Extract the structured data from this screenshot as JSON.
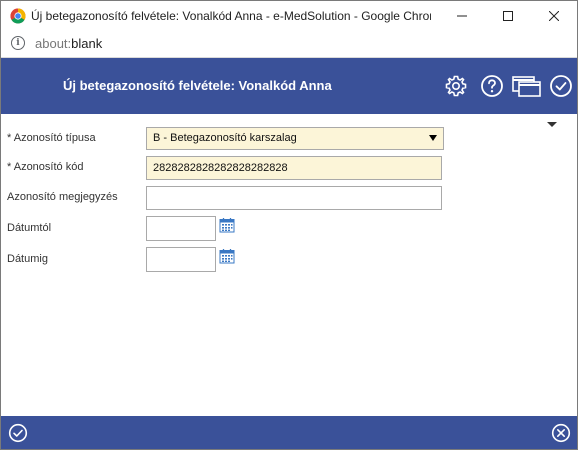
{
  "window": {
    "title": "Új betegazonosító felvétele: Vonalkód Anna - e-MedSolution - Google Chrome"
  },
  "address": {
    "scheme": "about:",
    "path": "blank"
  },
  "header": {
    "title": "Új betegazonosító felvétele: Vonalkód Anna"
  },
  "form": {
    "type": {
      "label": "* Azonosító típusa",
      "value": "B - Betegazonosító karszalag"
    },
    "code": {
      "label": "* Azonosító kód",
      "value": "2828282828282828282828"
    },
    "note": {
      "label": "Azonosító megjegyzés",
      "value": ""
    },
    "date_from": {
      "label": "Dátumtól",
      "value": ""
    },
    "date_to": {
      "label": "Dátumig",
      "value": ""
    }
  },
  "colors": {
    "header_bg": "#3a5199",
    "required_field_bg": "#fcf5d8"
  },
  "icons": {
    "header": [
      "settings-icon",
      "help-icon",
      "windows-icon",
      "check-circle-icon"
    ],
    "footer": [
      "ok-icon",
      "cancel-icon"
    ]
  }
}
